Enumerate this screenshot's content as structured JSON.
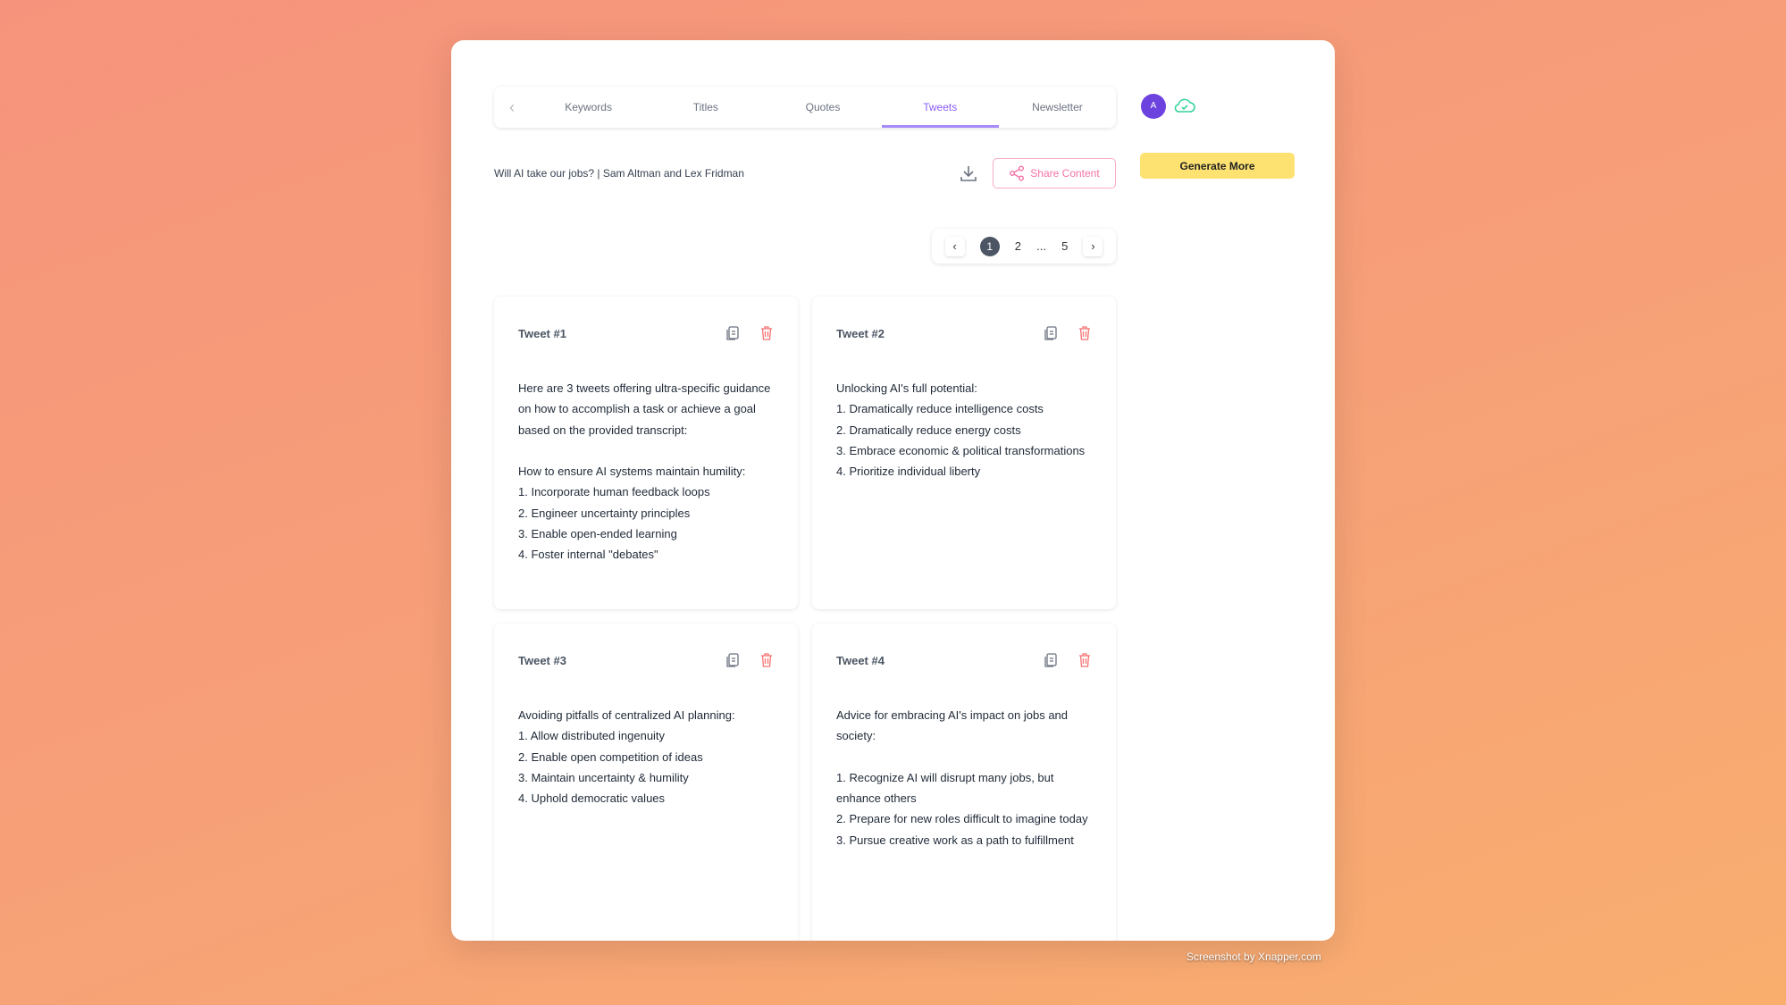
{
  "tabs": [
    "Keywords",
    "Titles",
    "Quotes",
    "Tweets",
    "Newsletter"
  ],
  "active_tab": "Tweets",
  "avatar_initial": "A",
  "generate_label": "Generate More",
  "video_title": "Will AI take our jobs? | Sam Altman and Lex Fridman",
  "share_label": "Share Content",
  "pagination": {
    "current": "1",
    "pages": [
      "2",
      "...",
      "5"
    ]
  },
  "tweets": [
    {
      "title": "Tweet #1",
      "body": "Here are 3 tweets offering ultra-specific guidance on how to accomplish a task or achieve a goal based on the provided transcript:\n\nHow to ensure AI systems maintain humility:\n1. Incorporate human feedback loops\n2. Engineer uncertainty principles\n3. Enable open-ended learning\n4. Foster internal \"debates\""
    },
    {
      "title": "Tweet #2",
      "body": "Unlocking AI's full potential:\n1. Dramatically reduce intelligence costs\n2. Dramatically reduce energy costs\n3. Embrace economic & political transformations\n4. Prioritize individual liberty"
    },
    {
      "title": "Tweet #3",
      "body": "Avoiding pitfalls of centralized AI planning:\n1. Allow distributed ingenuity\n2. Enable open competition of ideas\n3. Maintain uncertainty & humility\n4. Uphold democratic values"
    },
    {
      "title": "Tweet #4",
      "body": "Advice for embracing AI's impact on jobs and society:\n\n1. Recognize AI will disrupt many jobs, but enhance others\n2. Prepare for new roles difficult to imagine today\n3. Pursue creative work as a path to fulfillment"
    }
  ],
  "credit": "Screenshot by Xnapper.com",
  "colors": {
    "accent": "#8b5cf6",
    "generate": "#fde272",
    "share": "#f472a6",
    "delete": "#f87171"
  }
}
